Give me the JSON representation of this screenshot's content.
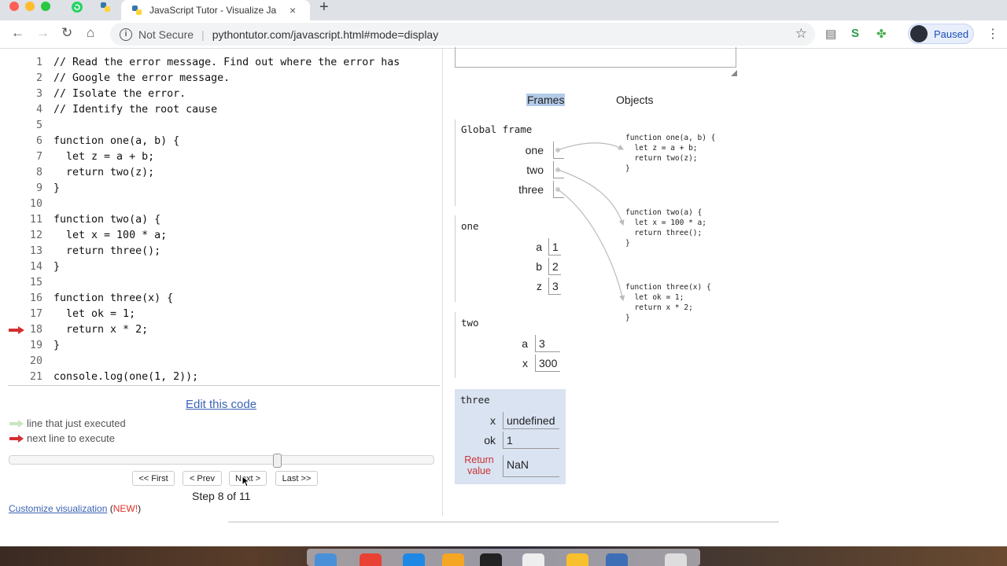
{
  "browser": {
    "tab_title": "JavaScript Tutor - Visualize Ja",
    "tab_close": "×",
    "new_tab": "+",
    "security_label": "Not Secure",
    "url": "pythontutor.com/javascript.html#mode=display",
    "profile_status": "Paused",
    "colors": {
      "close": "#ff5f57",
      "minimize": "#febc2e",
      "maximize": "#28c840"
    }
  },
  "code": {
    "current_line": 18,
    "lines": [
      {
        "n": "1",
        "t": "// Read the error message. Find out where the error has"
      },
      {
        "n": "2",
        "t": "// Google the error message."
      },
      {
        "n": "3",
        "t": "// Isolate the error."
      },
      {
        "n": "4",
        "t": "// Identify the root cause"
      },
      {
        "n": "5",
        "t": ""
      },
      {
        "n": "6",
        "t": "function one(a, b) {"
      },
      {
        "n": "7",
        "t": "  let z = a + b;"
      },
      {
        "n": "8",
        "t": "  return two(z);"
      },
      {
        "n": "9",
        "t": "}"
      },
      {
        "n": "10",
        "t": ""
      },
      {
        "n": "11",
        "t": "function two(a) {"
      },
      {
        "n": "12",
        "t": "  let x = 100 * a;"
      },
      {
        "n": "13",
        "t": "  return three();"
      },
      {
        "n": "14",
        "t": "}"
      },
      {
        "n": "15",
        "t": ""
      },
      {
        "n": "16",
        "t": "function three(x) {"
      },
      {
        "n": "17",
        "t": "  let ok = 1;"
      },
      {
        "n": "18",
        "t": "  return x * 2;"
      },
      {
        "n": "19",
        "t": "}"
      },
      {
        "n": "20",
        "t": ""
      },
      {
        "n": "21",
        "t": "console.log(one(1, 2));"
      }
    ]
  },
  "controls": {
    "edit_link": "Edit this code",
    "legend_executed": "line that just executed",
    "legend_next": "next line to execute",
    "first": "<< First",
    "prev": "< Prev",
    "next": "Next >",
    "last": "Last >>",
    "step_text": "Step 8 of 11",
    "step_current": 8,
    "step_total": 11,
    "customize_link": "Customize visualization",
    "new_open": " (",
    "new_badge": "NEW!",
    "new_close": ")",
    "colors": {
      "executed_arrow": "#c8e6c0",
      "next_arrow": "#d32f2f"
    }
  },
  "viz": {
    "tab_frames": "Frames",
    "tab_objects": "Objects",
    "global": {
      "name": "Global frame",
      "vars": [
        "one",
        "two",
        "three"
      ]
    },
    "frame_one": {
      "name": "one",
      "vars": [
        {
          "k": "a",
          "v": "1"
        },
        {
          "k": "b",
          "v": "2"
        },
        {
          "k": "z",
          "v": "3"
        }
      ]
    },
    "frame_two": {
      "name": "two",
      "vars": [
        {
          "k": "a",
          "v": "3"
        },
        {
          "k": "x",
          "v": "300"
        }
      ]
    },
    "frame_three": {
      "name": "three",
      "vars": [
        {
          "k": "x",
          "v": "undefined"
        },
        {
          "k": "ok",
          "v": "1"
        }
      ],
      "return_label": "Return value",
      "return_value": "NaN"
    },
    "objects": [
      "function one(a, b) {\n  let z = a + b;\n  return two(z);\n}",
      "function two(a) {\n  let x = 100 * a;\n  return three();\n}",
      "function three(x) {\n  let ok = 1;\n  return x * 2;\n}"
    ]
  }
}
